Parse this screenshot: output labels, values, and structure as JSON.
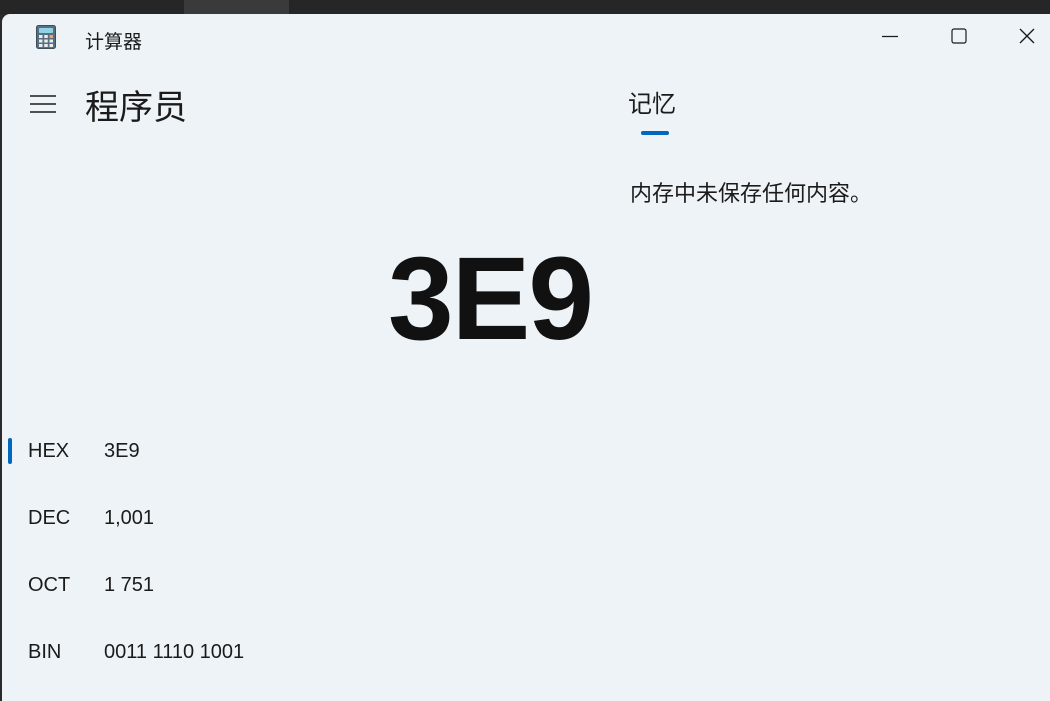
{
  "window": {
    "title": "计算器"
  },
  "header": {
    "mode_title": "程序员"
  },
  "display": {
    "value": "3E9"
  },
  "radix": [
    {
      "name": "HEX",
      "value": "3E9",
      "selected": true
    },
    {
      "name": "DEC",
      "value": "1,001",
      "selected": false
    },
    {
      "name": "OCT",
      "value": "1 751",
      "selected": false
    },
    {
      "name": "BIN",
      "value": "0011 1110 1001",
      "selected": false
    }
  ],
  "memory": {
    "tab_label": "记忆",
    "empty_message": "内存中未保存任何内容。"
  },
  "colors": {
    "accent": "#0067c0",
    "background": "#edf3f6",
    "text": "#1b1b1b"
  },
  "icons": {
    "app": "calculator-icon",
    "menu": "hamburger-menu-icon",
    "minimize": "minimize-icon",
    "maximize": "maximize-icon",
    "close": "close-icon"
  }
}
